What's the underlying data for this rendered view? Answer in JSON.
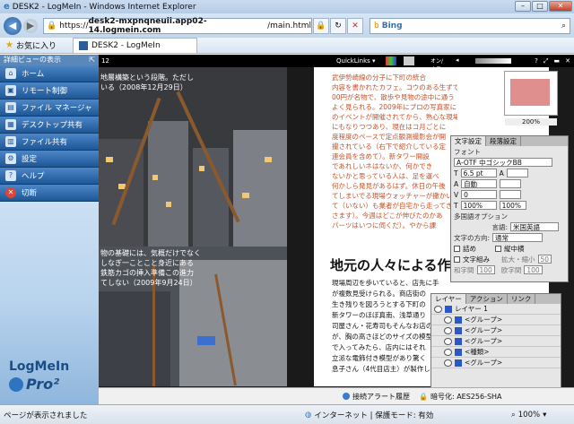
{
  "window": {
    "title": "DESK2 - LogMeIn - Windows Internet Explorer"
  },
  "address": {
    "url_prefix": "https://",
    "url_host": "desk2-mxpnqneuii.app02-14.logmein.com",
    "url_path": "/main.html",
    "search_placeholder": "Bing"
  },
  "favorites": {
    "label": "お気に入り",
    "tab_label": "DESK2 - LogMeIn"
  },
  "sidebar": {
    "header": "詳細ビューの表示",
    "items": [
      {
        "label": "ホーム",
        "icon": "home-icon"
      },
      {
        "label": "リモート制御",
        "icon": "remote-control-icon"
      },
      {
        "label": "ファイル マネージャ",
        "icon": "file-manager-icon"
      },
      {
        "label": "デスクトップ共有",
        "icon": "desktop-share-icon"
      },
      {
        "label": "ファイル共有",
        "icon": "file-share-icon"
      },
      {
        "label": "設定",
        "icon": "settings-icon"
      },
      {
        "label": "ヘルプ",
        "icon": "help-icon"
      },
      {
        "label": "切断",
        "icon": "disconnect-icon"
      }
    ],
    "logo_text": "LogMeIn",
    "logo_pro": "Pro²"
  },
  "remote": {
    "page_number": "12",
    "quicklinks_label": "QuickLinks",
    "toggle_label": "オン/オフ",
    "caption1": [
      "地層構築という段階。ただし",
      "いる（2008年12月29日）"
    ],
    "caption2": [
      "物の基礎には、気概だけでなく",
      "しなぎ一ことこと身近にある",
      "鉄筋カゴの挿入準備この進力",
      "てしない（2009年9月24日）"
    ],
    "article_lines": [
      "武伊勢崎線の分子に下町の統合",
      "内容を書かれたカフェ。コウのある生ずでのつ",
      "00円が名物で、散歩や見物の途中に通う",
      "よく見られる。2009年にプロの写真家によ",
      "のイベントが開催されてから、熟心な現場",
      "にもなりつつあり、現在はコ月ごとに",
      "度程度のペースで定点観測撮影会が開",
      "撮されている（右下で紹介している定",
      "連会員を含めて）。新タワー開設",
      "であれしいネはないか、何かでき",
      "ないかと思っている人は、足を運べ",
      "何かしら発見があるはず。休日の午後",
      "てしまいでる現場ウォッチャーが撒かい",
      "て（いない）も業者が自宅から走ってき",
      "さます）。今週はどこが伸びたのかあ",
      "パーツはいつに伺くだ）。やから課"
    ],
    "heading": "地元の人々による作",
    "body_lines": [
      "現場周辺を歩いていると、店先に手作",
      "が複数見受けられる。商店街の",
      "生き残りを図ろうとする下町の",
      "新タワーのほぼ真南、浅草通り",
      "司屋さん・花寿司もそんなお店の",
      "が、胸の高さほどのサイズの模型",
      "で入ってみたら、店内にはそれ",
      "立派な電飾付き模型があり驚く",
      "息子さん（4代目店主）が製作し"
    ],
    "thumb_zoom": "200%",
    "char_panel": {
      "tabs": [
        "文字設定",
        "段落設定"
      ],
      "font_label": "フォント",
      "font_value": "A-OTF 中ゴシックBB",
      "size": "6.5 pt",
      "leading": "自動",
      "tracking": "0",
      "scale_h": "100%",
      "scale_v": "100%",
      "multilang_label": "多国語オプション",
      "lang_label": "言語:",
      "lang_value": "米国英語",
      "direction_label": "文字の方向:",
      "direction_value": "通常",
      "opts": [
        "詰め",
        "縦中横",
        "文字組み",
        "拡大・縮小",
        "和字間",
        "欧字間"
      ],
      "opt_values": [
        "50",
        "100",
        "100"
      ]
    },
    "layer_panel": {
      "tabs": [
        "レイヤー",
        "アクション",
        "リンク"
      ],
      "rows": [
        "レイヤー 1",
        "<グループ>",
        "<グループ>",
        "<グループ>",
        "<種類>",
        "<グループ>"
      ]
    },
    "status": {
      "alert_label": "接続アラート履歴",
      "encryption_label": "暗号化: AES256-SHA"
    }
  },
  "iestatus": {
    "message": "ページが表示されました",
    "zone": "インターネット | 保護モード: 有効",
    "zoom": "100%"
  }
}
